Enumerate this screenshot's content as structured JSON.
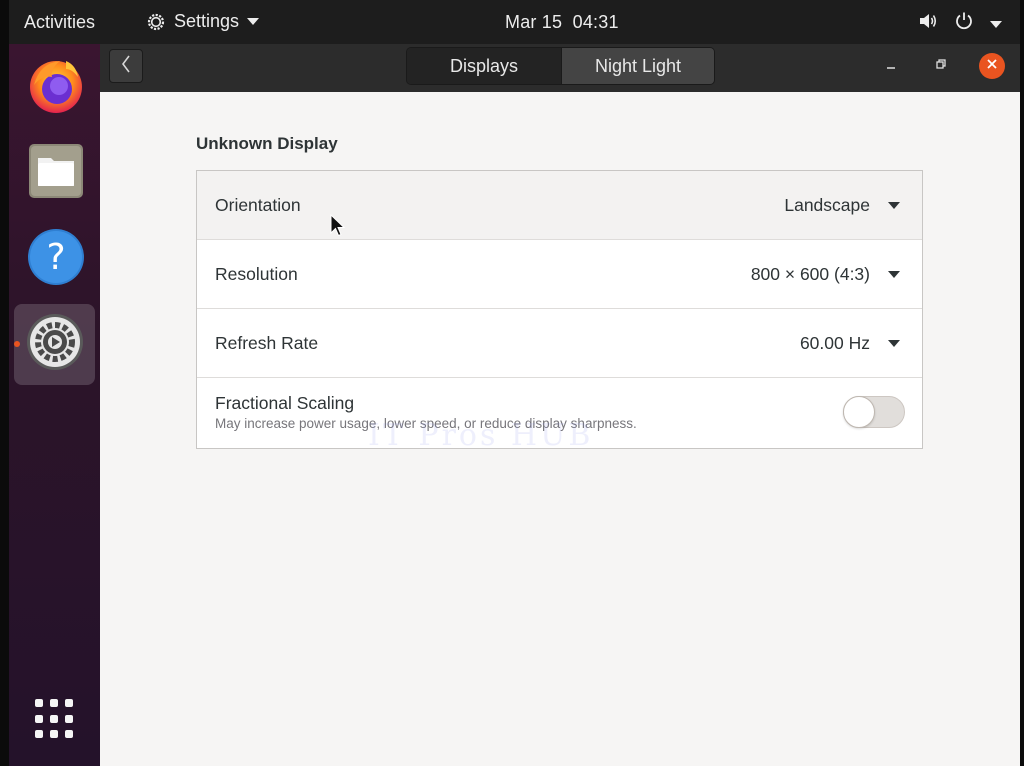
{
  "topbar": {
    "activities": "Activities",
    "app_name": "Settings",
    "clock": "Mar 15  04:31",
    "icons": [
      "gear-icon",
      "volume-icon",
      "power-icon",
      "chevron-down-icon"
    ]
  },
  "dock": {
    "items": [
      "firefox-icon",
      "files-icon",
      "help-icon",
      "settings-icon"
    ],
    "show_apps_icon": "grid-icon",
    "running_indicator_color": "#e95420"
  },
  "window": {
    "tabs": [
      {
        "label": "Displays",
        "selected": true
      },
      {
        "label": "Night Light",
        "selected": false
      }
    ],
    "controls": [
      "minimize-icon",
      "maximize-icon",
      "close-icon"
    ],
    "accent": "#e95420"
  },
  "display": {
    "title": "Unknown Display",
    "rows": [
      {
        "label": "Orientation",
        "value": "Landscape"
      },
      {
        "label": "Resolution",
        "value": "800 × 600 (4:3)"
      },
      {
        "label": "Refresh Rate",
        "value": "60.00 Hz"
      }
    ],
    "fractional_scaling": {
      "label": "Fractional Scaling",
      "description": "May increase power usage, lower speed, or reduce display sharpness.",
      "enabled": false
    }
  },
  "watermark": "IT Pros HUB"
}
